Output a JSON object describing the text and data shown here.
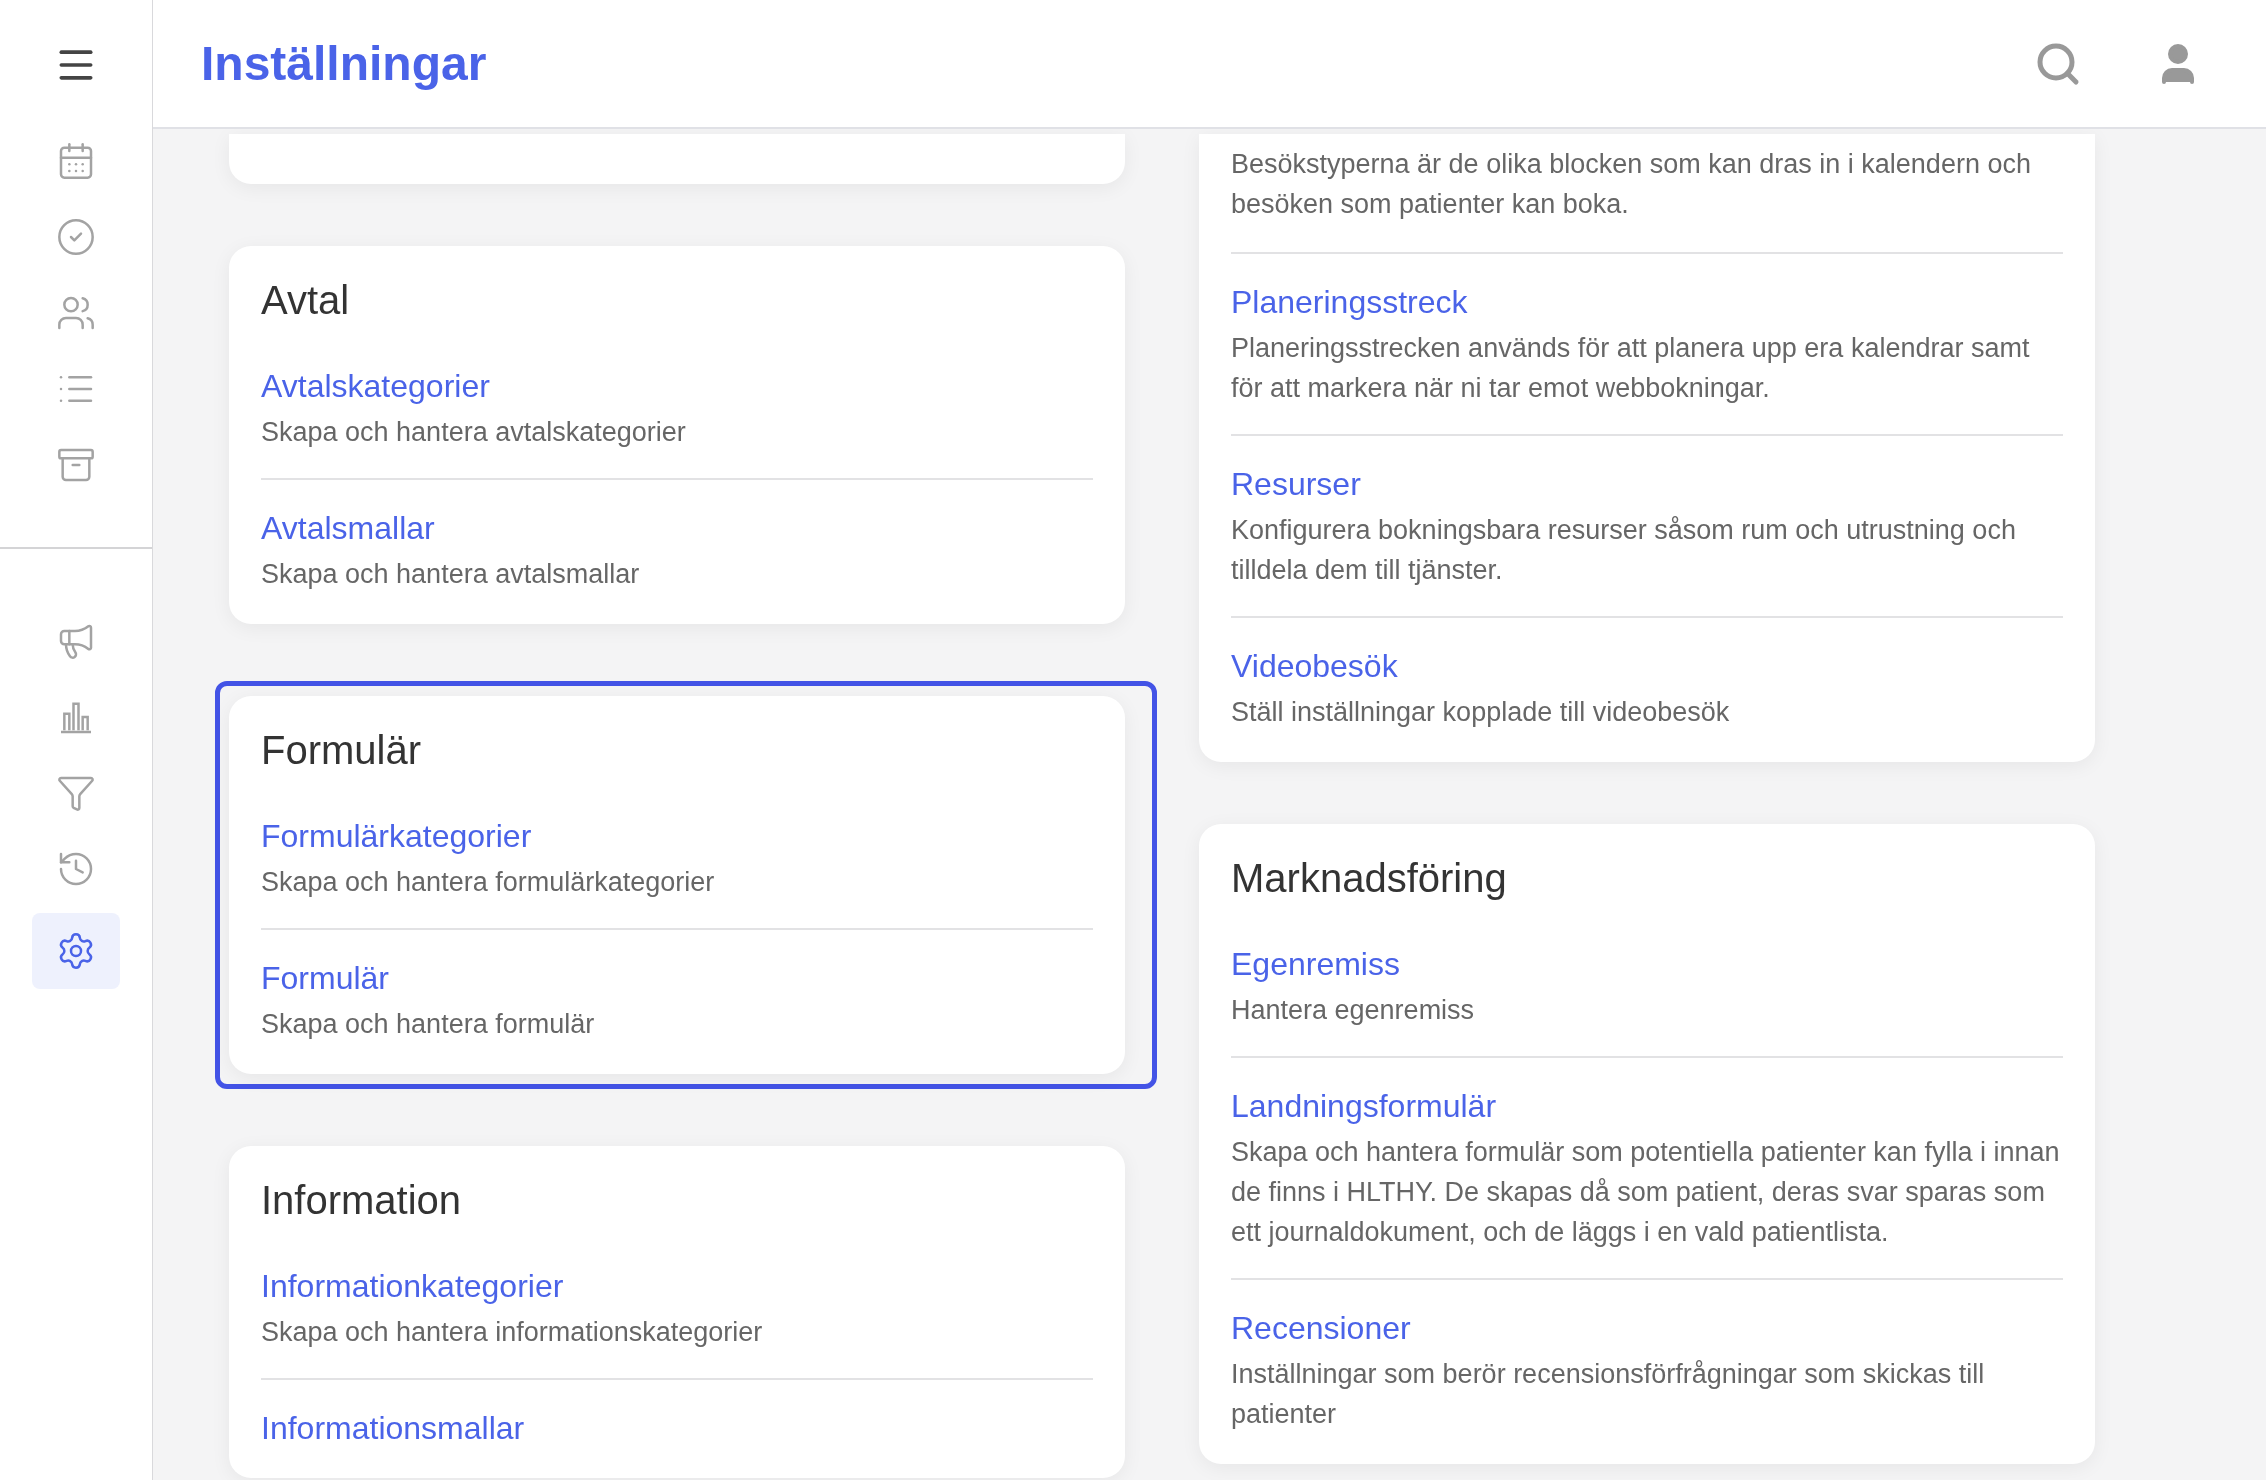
{
  "sidebar": {
    "groups": [
      {
        "items": [
          {
            "selected": false
          },
          {
            "selected": false
          },
          {
            "selected": false
          },
          {
            "selected": false
          },
          {
            "selected": false
          }
        ]
      },
      {
        "items": [
          {
            "selected": false
          },
          {
            "selected": false
          },
          {
            "selected": false
          },
          {
            "selected": false
          },
          {
            "selected": true
          }
        ]
      }
    ]
  },
  "header": {
    "title": "Inställningar"
  },
  "left_column": [
    {
      "kind": "fragment"
    },
    {
      "kind": "card",
      "title": "Avtal",
      "highlighted": false,
      "links": [
        {
          "title": "Avtalskategorier",
          "description": "Skapa och hantera avtalskategorier"
        },
        {
          "title": "Avtalsmallar",
          "description": "Skapa och hantera avtalsmallar"
        }
      ]
    },
    {
      "kind": "card",
      "title": "Formulär",
      "highlighted": true,
      "links": [
        {
          "title": "Formulärkategorier",
          "description": "Skapa och hantera formulärkategorier"
        },
        {
          "title": "Formulär",
          "description": "Skapa och hantera formulär"
        }
      ]
    },
    {
      "kind": "card",
      "title": "Information",
      "highlighted": false,
      "links": [
        {
          "title": "Informationkategorier",
          "description": "Skapa och hantera informationskategorier"
        },
        {
          "title": "Informationsmallar"
        }
      ]
    }
  ],
  "right_column": [
    {
      "kind": "card",
      "intro": "Besökstyperna är de olika blocken som kan dras in i kalendern och besöken som patienter kan boka.",
      "highlighted": false,
      "links": [
        {
          "title": "Planeringsstreck",
          "description": "Planeringsstrecken används för att planera upp era kalendrar samt för att markera när ni tar emot webbokningar."
        },
        {
          "title": "Resurser",
          "description": "Konfigurera bokningsbara resurser såsom rum och utrustning och tilldela dem till tjänster."
        },
        {
          "title": "Videobesök",
          "description": "Ställ inställningar kopplade till videobesök"
        }
      ]
    },
    {
      "kind": "card",
      "title": "Marknadsföring",
      "highlighted": false,
      "links": [
        {
          "title": "Egenremiss",
          "description": "Hantera egenremiss"
        },
        {
          "title": "Landningsformulär",
          "description": "Skapa och hantera formulär som potentiella patienter kan fylla i innan de finns i HLTHY. De skapas då som patient, deras svar sparas som ett journaldokument, och de läggs i en vald patientlista."
        },
        {
          "title": "Recensioner",
          "description": "Inställningar som berör recensionsförfrågningar som skickas till patienter"
        }
      ]
    }
  ]
}
